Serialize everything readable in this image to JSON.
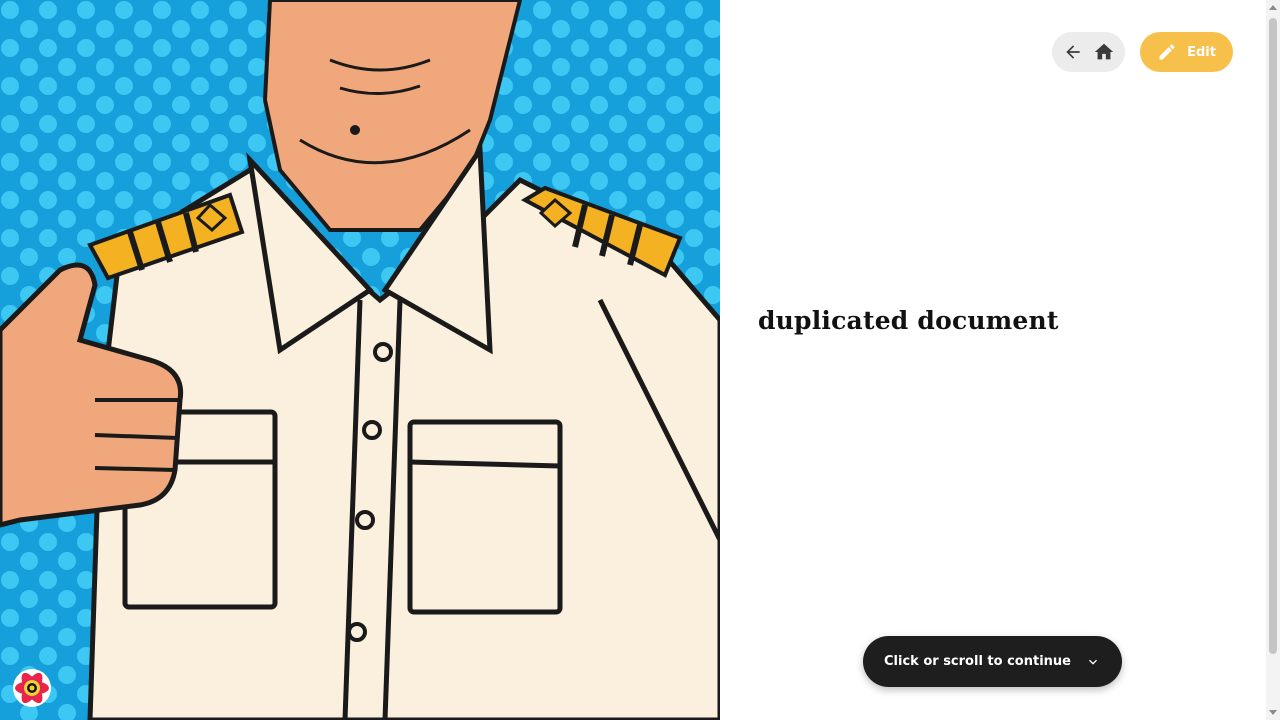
{
  "hero": {
    "image": "pop-art-captain-thumbs-up",
    "icon": "pop-art-illustration",
    "colors": {
      "background": "#1aa6df",
      "dots": "#39c6f0",
      "shirt": "#fbf0de",
      "skin": "#f0a77c",
      "epaulette": "#f4b223"
    }
  },
  "header": {
    "back_icon": "arrow-left-icon",
    "home_icon": "home-icon",
    "edit_icon": "pencil-icon",
    "edit_label": "Edit",
    "edit_color": "#f6c04a"
  },
  "document": {
    "title": "duplicated document"
  },
  "continue": {
    "label": "Click or scroll to continue",
    "icon": "chevron-down-icon"
  },
  "badge": {
    "icon": "react-logo-icon"
  }
}
